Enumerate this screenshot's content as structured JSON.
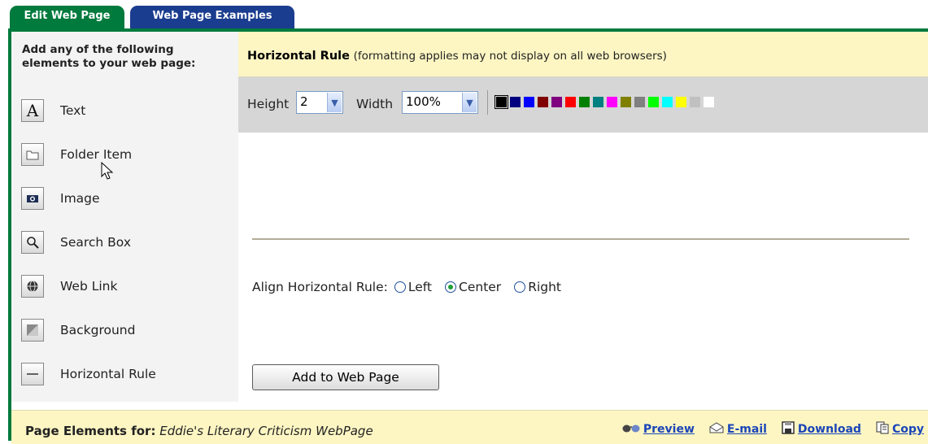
{
  "tabs": [
    {
      "label": "Edit Web Page"
    },
    {
      "label": "Web Page Examples"
    }
  ],
  "sidebar": {
    "title": "Add any of the following elements to your web page:",
    "items": [
      {
        "label": "Text",
        "icon": "text-A-icon"
      },
      {
        "label": "Folder Item",
        "icon": "folder-icon"
      },
      {
        "label": "Image",
        "icon": "camera-icon"
      },
      {
        "label": "Search Box",
        "icon": "magnifier-icon"
      },
      {
        "label": "Web Link",
        "icon": "globe-link-icon"
      },
      {
        "label": "Background",
        "icon": "background-icon"
      },
      {
        "label": "Horizontal Rule",
        "icon": "horizontal-rule-icon"
      }
    ]
  },
  "editor": {
    "title": "Horizontal Rule",
    "title_note": "(formatting applies may not display on all web browsers)",
    "height_label": "Height",
    "height_value": "2",
    "width_label": "Width",
    "width_value": "100%",
    "colors": [
      "#000000",
      "#000080",
      "#0000ff",
      "#800000",
      "#800080",
      "#ff0000",
      "#008000",
      "#008080",
      "#ff00ff",
      "#808000",
      "#808080",
      "#00ff00",
      "#00ffff",
      "#ffff00",
      "#c0c0c0",
      "#ffffff"
    ],
    "selected_color": "#000000",
    "align_label": "Align Horizontal Rule:",
    "align_options": [
      "Left",
      "Center",
      "Right"
    ],
    "align_selected": "Center",
    "add_button": "Add to Web Page"
  },
  "footer": {
    "label": "Page Elements for:",
    "page_name": "Eddie's Literary Criticism WebPage",
    "links": [
      {
        "label": "Preview",
        "icon": "glasses-icon"
      },
      {
        "label": "E-mail",
        "icon": "envelope-icon"
      },
      {
        "label": "Download",
        "icon": "floppy-disk-icon"
      },
      {
        "label": "Copy",
        "icon": "copy-icon"
      }
    ]
  }
}
